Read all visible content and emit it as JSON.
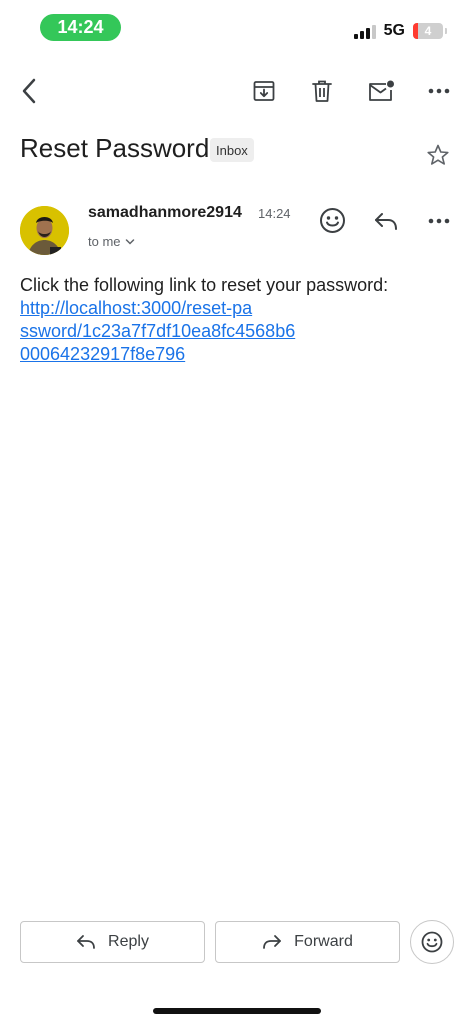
{
  "status_bar": {
    "time": "14:24",
    "network": "5G",
    "battery": "4"
  },
  "toolbar": {
    "icons": [
      "back-icon",
      "archive-icon",
      "trash-icon",
      "mark-unread-icon",
      "more-icon"
    ]
  },
  "email": {
    "subject": "Reset Password",
    "label": "Inbox",
    "sender": "samadhanmore2914",
    "time": "14:24",
    "to": "to me",
    "body_text": "Click the following link to reset your password:",
    "link_lines": [
      "http://localhost:3000/reset-pa",
      "ssword/1c23a7f7df10ea8fc4568b6",
      "00064232917f8e796"
    ]
  },
  "actions": {
    "reply_label": "Reply",
    "forward_label": "Forward"
  }
}
